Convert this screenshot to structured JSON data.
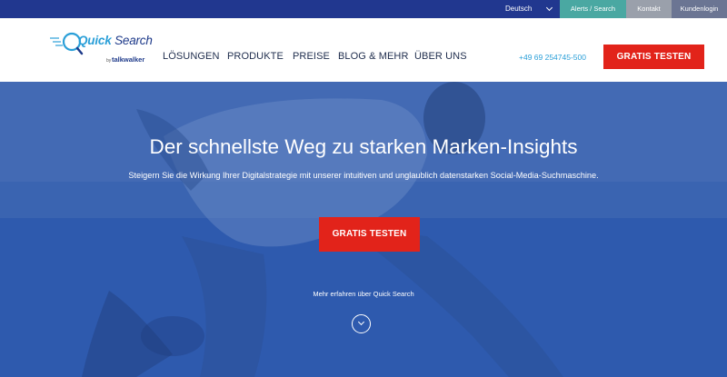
{
  "topbar": {
    "language": "Deutsch",
    "alerts_search": "Alerts / Search",
    "kontakt": "Kontakt",
    "kundenlogin": "Kundenlogin"
  },
  "logo": {
    "name_quick": "Quick",
    "name_search": "Search",
    "by": "by",
    "parent": "talkwalker"
  },
  "nav": {
    "items": [
      "LÖSUNGEN",
      "PRODUKTE",
      "PREISE",
      "BLOG & MEHR",
      "ÜBER UNS"
    ]
  },
  "header": {
    "phone": "+49 69 254745-500",
    "cta": "GRATIS TESTEN"
  },
  "hero": {
    "title": "Der schnellste Weg zu starken Marken-Insights",
    "subtitle": "Steigern Sie die Wirkung Ihrer Digitalstrategie mit unserer intuitiven und unglaublich datenstarken Social-Media-Suchmaschine.",
    "cta": "GRATIS TESTEN",
    "more": "Mehr erfahren über Quick Search"
  },
  "colors": {
    "topbar": "#21378f",
    "accent_red": "#e2231a",
    "hero_blue": "#2e5ab0",
    "alerts_teal": "#4aa8a2",
    "link_blue": "#2a9fd8"
  },
  "icons": {
    "language_toggle": "chevron-down-icon",
    "logo_mark": "magnifier-icon",
    "scroll_down": "chevron-down-circle-icon"
  }
}
